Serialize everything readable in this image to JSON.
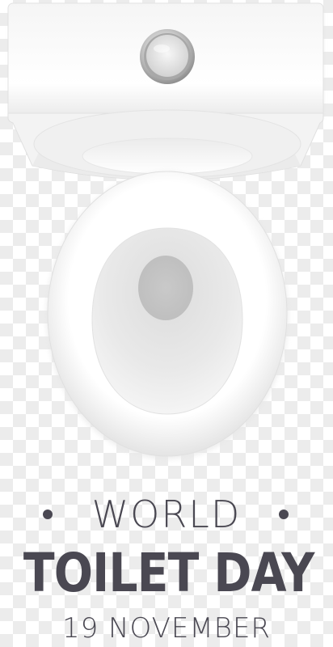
{
  "poster": {
    "line1": "WORLD",
    "line2": "TOILET DAY",
    "line3": "19 NOVEMBER"
  },
  "colors": {
    "text": "#4a4852",
    "porcelain": "#ffffff",
    "background_check": "#ececec"
  },
  "icons": {
    "illustration": "toilet-top-view",
    "flush": "flush-button-icon",
    "separator": "bullet-dot"
  }
}
